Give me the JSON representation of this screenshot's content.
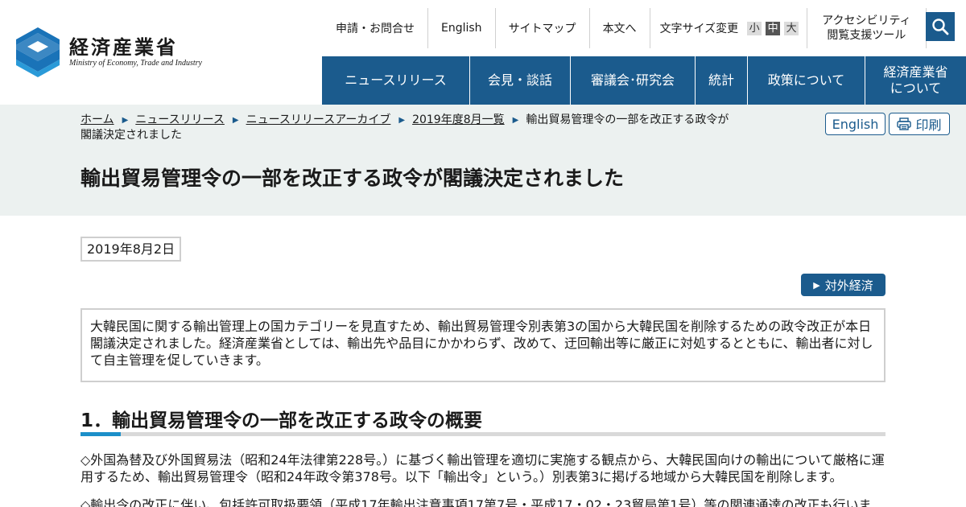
{
  "header": {
    "logo_ja": "経済産業省",
    "logo_en": "Ministry of Economy, Trade and Industry",
    "util": {
      "apply": "申請・お問合せ",
      "english": "English",
      "sitemap": "サイトマップ",
      "main_text": "本文へ",
      "font_size_label": "文字サイズ変更",
      "font_small": "小",
      "font_medium": "中",
      "font_large": "大",
      "accessibility_line1": "アクセシビリティ",
      "accessibility_line2": "閲覧支援ツール"
    },
    "search_icon": "search-icon",
    "nav": [
      {
        "label": "ニュースリリース"
      },
      {
        "label": "会見・談話"
      },
      {
        "label": "審議会･研究会"
      },
      {
        "label": "統計"
      },
      {
        "label": "政策について"
      },
      {
        "label_line1": "経済産業省",
        "label_line2": "について"
      }
    ]
  },
  "breadcrumb": {
    "items": [
      "ホーム",
      "ニュースリリース",
      "ニュースリリースアーカイブ",
      "2019年度8月一覧"
    ],
    "current_line1": "輸出貿易管理令の一部を改正する政令が",
    "current_line2": "閣議決定されました"
  },
  "actions": {
    "english": "English",
    "print": "印刷"
  },
  "page_title": "輸出貿易管理令の一部を改正する政令が閣議決定されました",
  "date": "2019年8月2日",
  "category_tag": "対外経済",
  "summary": "大韓民国に関する輸出管理上の国カテゴリーを見直すため、輸出貿易管理令別表第3の国から大韓民国を削除するための政令改正が本日閣議決定されました。経済産業省としては、輸出先や品目にかかわらず、改めて、迂回輸出等に厳正に対処するとともに、輸出者に対して自主管理を促していきます。",
  "section1": {
    "heading": "1．輸出貿易管理令の一部を改正する政令の概要",
    "para1": "◇外国為替及び外国貿易法（昭和24年法律第228号。）に基づく輸出管理を適切に実施する観点から、大韓民国向けの輸出について厳格に運用するため、輸出貿易管理令（昭和24年政令第378号。以下「輸出令」という。）別表第3に掲げる地域から大韓民国を削除します。",
    "para2": "◇輸出令の改正に伴い、包括許可取扱要領（平成17年輸出注意事項17第7号・平成17・02・23貿局第1号）等の関連通達の改正も行いま"
  },
  "colors": {
    "brand_navy": "#1b5b8d",
    "band_bg": "#ecf1f0",
    "heading_accent": "#1b8fc9",
    "logo_blue": "#1a73b8"
  }
}
